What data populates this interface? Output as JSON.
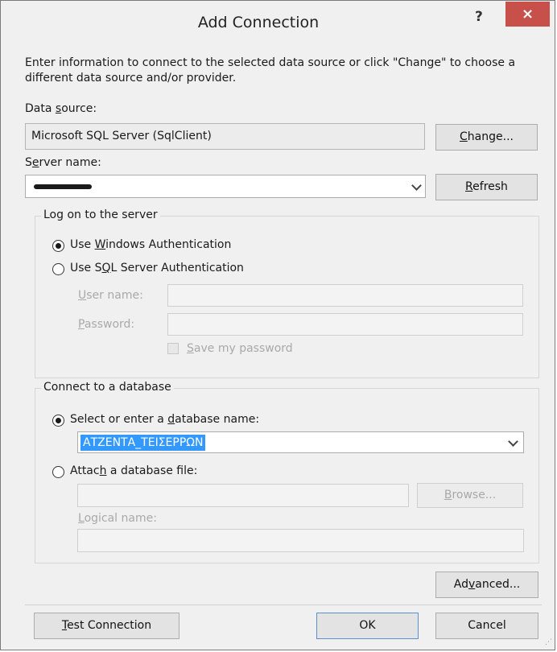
{
  "window": {
    "title": "Add Connection",
    "help_label": "?",
    "close_label": "×"
  },
  "intro_text": "Enter information to connect to the selected data source or click \"Change\" to choose a different data source and/or provider.",
  "data_source": {
    "label_pre": "Data ",
    "label_key": "s",
    "label_post": "ource:",
    "value": "Microsoft SQL Server (SqlClient)",
    "change_pre": "",
    "change_key": "C",
    "change_post": "hange..."
  },
  "server": {
    "label_pre": "S",
    "label_key": "e",
    "label_post": "rver name:",
    "value": "",
    "refresh_pre": "",
    "refresh_key": "R",
    "refresh_post": "efresh"
  },
  "logon": {
    "group_label": "Log on to the server",
    "windows_auth": {
      "pre": "Use ",
      "key": "W",
      "post": "indows Authentication",
      "selected": true
    },
    "sql_auth": {
      "pre": "Use S",
      "key": "Q",
      "post": "L Server Authentication",
      "selected": false
    },
    "username": {
      "pre": "",
      "key": "U",
      "post": "ser name:",
      "value": ""
    },
    "password": {
      "pre": "",
      "key": "P",
      "post": "assword:",
      "value": ""
    },
    "save_password": {
      "pre": "",
      "key": "S",
      "post": "ave my password",
      "checked": false
    }
  },
  "database": {
    "group_label": "Connect to a database",
    "select_option": {
      "pre": "Select or enter a ",
      "key": "d",
      "post": "atabase name:",
      "selected": true
    },
    "db_name": "ΑΤΖΕΝΤΑ_ΤΕΙΣΕΡΡΩΝ",
    "attach_option": {
      "pre": "Attac",
      "key": "h",
      "post": " a database file:",
      "selected": false
    },
    "attach_path": "",
    "browse": {
      "pre": "",
      "key": "B",
      "post": "rowse..."
    },
    "logical_name": {
      "pre": "",
      "key": "L",
      "post": "ogical name:",
      "value": ""
    }
  },
  "advanced": {
    "pre": "Ad",
    "key": "v",
    "post": "anced..."
  },
  "footer": {
    "test": {
      "pre": "",
      "key": "T",
      "post": "est Connection"
    },
    "ok_label": "OK",
    "cancel_label": "Cancel"
  }
}
